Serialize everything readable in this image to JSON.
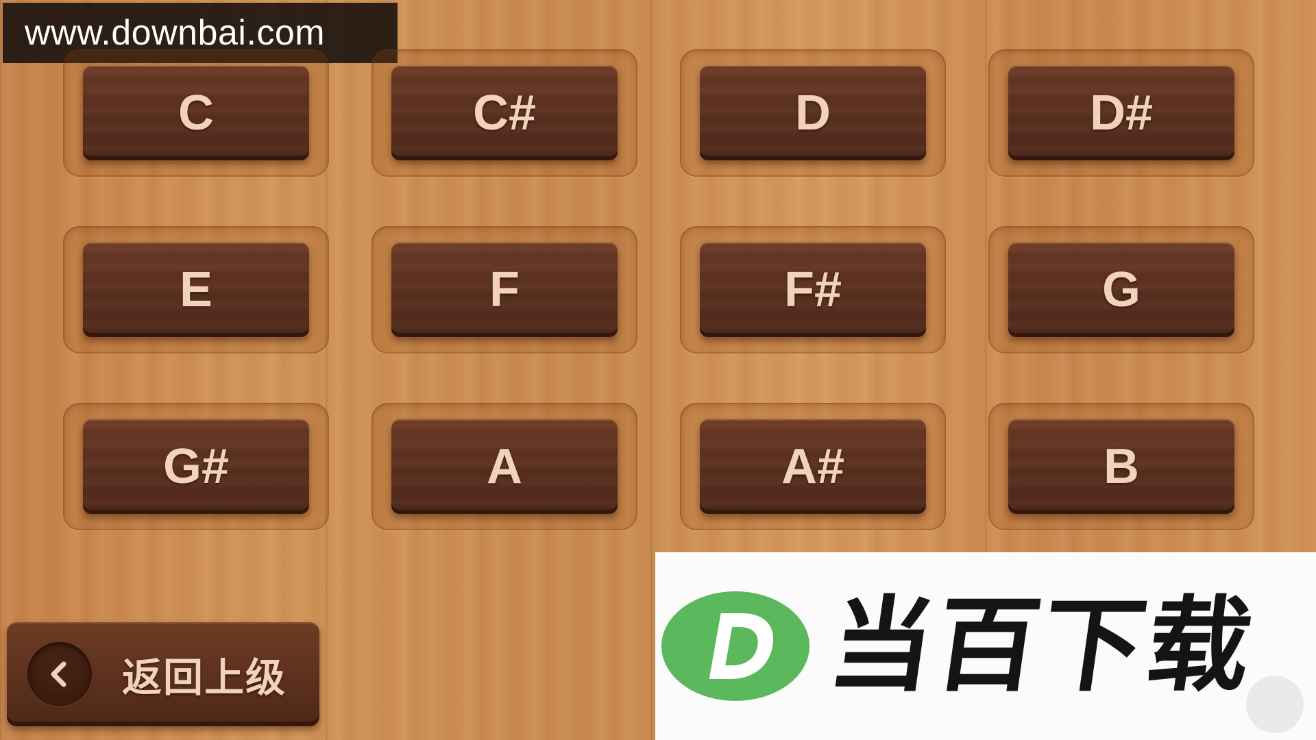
{
  "watermark": {
    "text": "www.downbai.com"
  },
  "notes": [
    {
      "label": "C"
    },
    {
      "label": "C#"
    },
    {
      "label": "D"
    },
    {
      "label": "D#"
    },
    {
      "label": "E"
    },
    {
      "label": "F"
    },
    {
      "label": "F#"
    },
    {
      "label": "G"
    },
    {
      "label": "G#"
    },
    {
      "label": "A"
    },
    {
      "label": "A#"
    },
    {
      "label": "B"
    }
  ],
  "back_button": {
    "label": "返回上级",
    "icon": "chevron-left-icon"
  },
  "brand": {
    "name": "当百下载",
    "logo_letter": "D",
    "logo_color": "#5cb85c"
  }
}
